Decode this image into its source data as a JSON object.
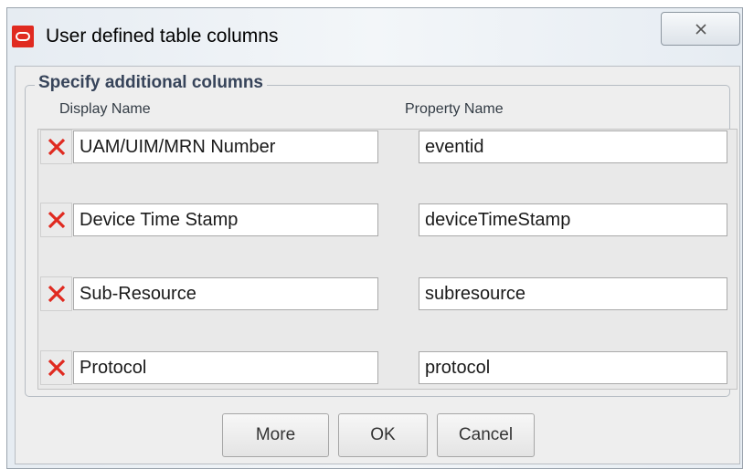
{
  "window": {
    "title": "User defined table columns"
  },
  "group": {
    "title": "Specify additional columns"
  },
  "columns": {
    "display_name": "Display Name",
    "property_name": "Property Name"
  },
  "rows": [
    {
      "display_name": "UAM/UIM/MRN Number",
      "property_name": "eventid"
    },
    {
      "display_name": "Device Time Stamp",
      "property_name": "deviceTimeStamp"
    },
    {
      "display_name": "Sub-Resource",
      "property_name": "subresource"
    },
    {
      "display_name": "Protocol",
      "property_name": "protocol"
    }
  ],
  "buttons": {
    "more": "More",
    "ok": "OK",
    "cancel": "Cancel"
  },
  "colors": {
    "accent": "#e02a20",
    "group_title": "#37445a"
  },
  "icons": {
    "app": "oracle-icon",
    "close": "close-icon",
    "delete": "delete-x-icon"
  }
}
